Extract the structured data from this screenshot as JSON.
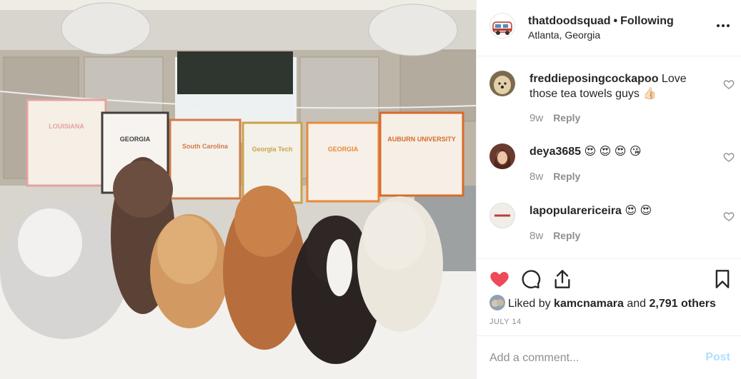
{
  "post": {
    "username": "thatdoodsquad",
    "separator": "•",
    "follow_status": "Following",
    "location": "Atlanta, Georgia"
  },
  "comments": [
    {
      "user": "freddieposingcockapoo",
      "text": "Love those tea towels guys 👍🏻",
      "age": "9w",
      "reply_label": "Reply"
    },
    {
      "user": "deya3685",
      "text": "😍 😍 😍 😘",
      "age": "8w",
      "reply_label": "Reply"
    },
    {
      "user": "lapopularericeira",
      "text": "😍 😍",
      "age": "8w",
      "reply_label": "Reply"
    }
  ],
  "actions": {
    "liked": true,
    "icons": [
      "heart-filled-icon",
      "comment-icon",
      "share-icon",
      "bookmark-icon"
    ]
  },
  "likes": {
    "prefix": "Liked by",
    "user": "kamcnamara",
    "middle": "and",
    "others": "2,791 others"
  },
  "date": "JULY 14",
  "add_comment": {
    "placeholder": "Add a comment...",
    "post_label": "Post"
  },
  "photo": {
    "towels": [
      {
        "text": "LOUISIANA"
      },
      {
        "text": "GEORGIA"
      },
      {
        "text": "South Carolina"
      },
      {
        "text": "Georgia Tech"
      },
      {
        "text": "GEORGIA"
      },
      {
        "text": "AUBURN UNIVERSITY"
      }
    ]
  },
  "colors": {
    "like_red": "#ed4956",
    "post_disabled": "#b2dffc",
    "muted": "#8e8e8e"
  }
}
